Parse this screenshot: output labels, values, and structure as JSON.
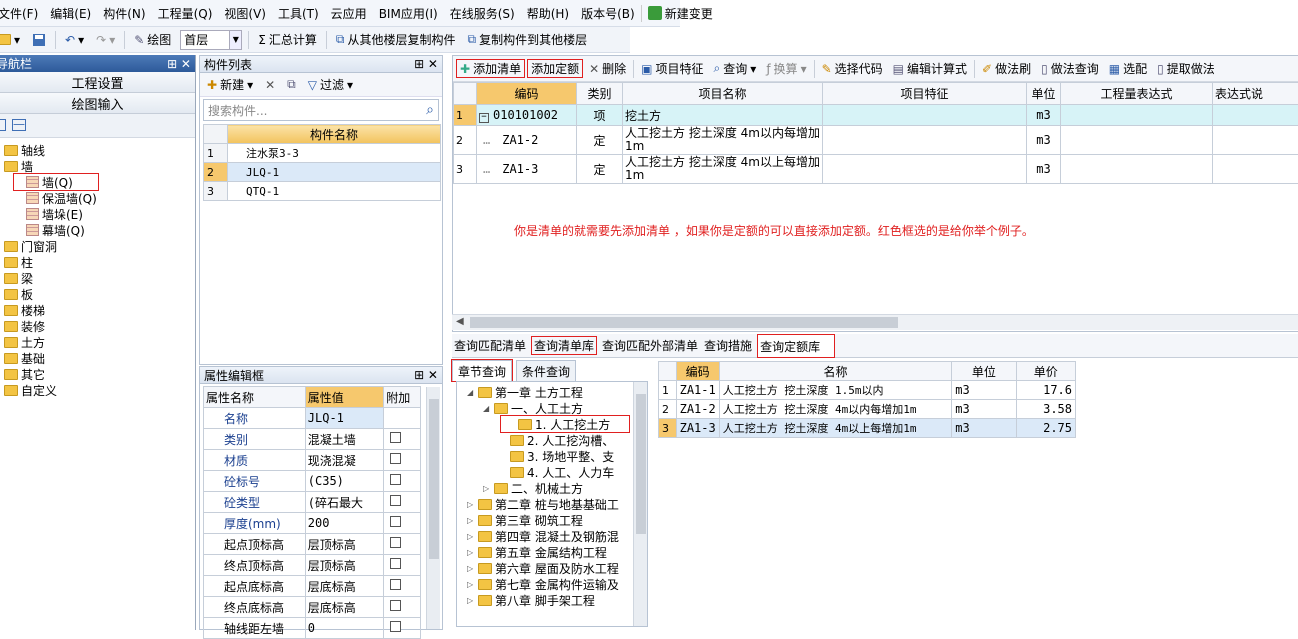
{
  "menu": [
    "文件(F)",
    "编辑(E)",
    "构件(N)",
    "工程量(Q)",
    "视图(V)",
    "工具(T)",
    "云应用",
    "BIM应用(I)",
    "在线服务(S)",
    "帮助(H)",
    "版本号(B)",
    "新建变更"
  ],
  "toolbar": {
    "draw": "绘图",
    "floor": "首层",
    "sum": "汇总计算",
    "copy_from": "从其他楼层复制构件",
    "copy_to": "复制构件到其他楼层"
  },
  "nav": {
    "title": "导航栏",
    "btn_settings": "工程设置",
    "btn_draw": "绘图输入",
    "tree": [
      {
        "label": "轴线",
        "level": 0,
        "icon": "folder"
      },
      {
        "label": "墙",
        "level": 0,
        "icon": "folder"
      },
      {
        "label": "墙(Q)",
        "level": 1,
        "icon": "wall"
      },
      {
        "label": "保温墙(Q)",
        "level": 1,
        "icon": "wall"
      },
      {
        "label": "墙垛(E)",
        "level": 1,
        "icon": "wall"
      },
      {
        "label": "幕墙(Q)",
        "level": 1,
        "icon": "wall"
      },
      {
        "label": "门窗洞",
        "level": 0,
        "icon": "folder"
      },
      {
        "label": "柱",
        "level": 0,
        "icon": "folder"
      },
      {
        "label": "梁",
        "level": 0,
        "icon": "folder"
      },
      {
        "label": "板",
        "level": 0,
        "icon": "folder"
      },
      {
        "label": "楼梯",
        "level": 0,
        "icon": "folder"
      },
      {
        "label": "装修",
        "level": 0,
        "icon": "folder"
      },
      {
        "label": "土方",
        "level": 0,
        "icon": "folder"
      },
      {
        "label": "基础",
        "level": 0,
        "icon": "folder"
      },
      {
        "label": "其它",
        "level": 0,
        "icon": "folder"
      },
      {
        "label": "自定义",
        "level": 0,
        "icon": "folder"
      }
    ]
  },
  "complist": {
    "title": "构件列表",
    "new": "新建",
    "filter": "过滤",
    "search_placeholder": "搜索构件...",
    "header": "构件名称",
    "rows": [
      {
        "n": "1",
        "name": "注水泵3-3"
      },
      {
        "n": "2",
        "name": "JLQ-1"
      },
      {
        "n": "3",
        "name": "QTQ-1"
      }
    ]
  },
  "props": {
    "title": "属性编辑框",
    "headers": [
      "属性名称",
      "属性值",
      "附加"
    ],
    "rows": [
      {
        "name": "名称",
        "value": "JLQ-1",
        "blue": true,
        "chk": false
      },
      {
        "name": "类别",
        "value": "混凝土墙",
        "blue": true,
        "chk": true
      },
      {
        "name": "材质",
        "value": "现浇混凝",
        "blue": true,
        "chk": true
      },
      {
        "name": "砼标号",
        "value": "(C35)",
        "blue": true,
        "chk": true
      },
      {
        "name": "砼类型",
        "value": "(碎石最大",
        "blue": true,
        "chk": true
      },
      {
        "name": "厚度(mm)",
        "value": "200",
        "blue": true,
        "chk": true
      },
      {
        "name": "起点顶标高",
        "value": "层顶标高",
        "blue": false,
        "chk": true
      },
      {
        "name": "终点顶标高",
        "value": "层顶标高",
        "blue": false,
        "chk": true
      },
      {
        "name": "起点底标高",
        "value": "层底标高",
        "blue": false,
        "chk": true
      },
      {
        "name": "终点底标高",
        "value": "层底标高",
        "blue": false,
        "chk": true
      },
      {
        "name": "轴线距左墙",
        "value": "0",
        "blue": false,
        "chk": true
      }
    ]
  },
  "rtool": {
    "add_list": "添加清单",
    "add_quota": "添加定额",
    "delete": "删除",
    "feature": "项目特征",
    "query": "查询",
    "convert": "换算",
    "select_code": "选择代码",
    "edit_formula": "编辑计算式",
    "method_brush": "做法刷",
    "method_query": "做法查询",
    "select_fit": "选配",
    "extract": "提取做法"
  },
  "main": {
    "headers": [
      "编码",
      "类别",
      "项目名称",
      "项目特征",
      "单位",
      "工程量表达式",
      "表达式说"
    ],
    "rows": [
      {
        "n": "1",
        "code": "010101002",
        "type": "项",
        "name": "挖土方",
        "feature": "",
        "unit": "m3"
      },
      {
        "n": "2",
        "code": "ZA1-2",
        "type": "定",
        "name": "人工挖土方 挖土深度 4m以内每增加1m",
        "feature": "",
        "unit": "m3"
      },
      {
        "n": "3",
        "code": "ZA1-3",
        "type": "定",
        "name": "人工挖土方 挖土深度 4m以上每增加1m",
        "feature": "",
        "unit": "m3"
      }
    ],
    "note": "你是清单的就需要先添加清单  ，如果你是定额的可以直接添加定额。红色框选的是给你举个例子。"
  },
  "btabs": [
    "查询匹配清单",
    "查询清单库",
    "查询匹配外部清单",
    "查询措施",
    "查询定额库"
  ],
  "subtabs": [
    "章节查询",
    "条件查询"
  ],
  "chapters": [
    {
      "label": "第一章 土方工程",
      "level": 0,
      "open": true
    },
    {
      "label": "一、人工土方",
      "level": 1,
      "open": true
    },
    {
      "label": "1. 人工挖土方",
      "level": 2,
      "hl": true
    },
    {
      "label": "2. 人工挖沟槽、",
      "level": 2
    },
    {
      "label": "3. 场地平整、支",
      "level": 2
    },
    {
      "label": "4. 人工、人力车",
      "level": 2
    },
    {
      "label": "二、机械土方",
      "level": 1
    },
    {
      "label": "第二章 桩与地基基础工",
      "level": 0
    },
    {
      "label": "第三章 砌筑工程",
      "level": 0
    },
    {
      "label": "第四章 混凝土及钢筋混",
      "level": 0
    },
    {
      "label": "第五章 金属结构工程",
      "level": 0
    },
    {
      "label": "第六章 屋面及防水工程",
      "level": 0
    },
    {
      "label": "第七章 金属构件运输及",
      "level": 0
    },
    {
      "label": "第八章 脚手架工程",
      "level": 0
    }
  ],
  "quota": {
    "headers": [
      "编码",
      "名称",
      "单位",
      "单价"
    ],
    "rows": [
      {
        "n": "1",
        "code": "ZA1-1",
        "name": "人工挖土方 挖土深度 1.5m以内",
        "unit": "m3",
        "price": "17.6"
      },
      {
        "n": "2",
        "code": "ZA1-2",
        "name": "人工挖土方 挖土深度 4m以内每增加1m",
        "unit": "m3",
        "price": "3.58"
      },
      {
        "n": "3",
        "code": "ZA1-3",
        "name": "人工挖土方 挖土深度 4m以上每增加1m",
        "unit": "m3",
        "price": "2.75"
      }
    ]
  }
}
